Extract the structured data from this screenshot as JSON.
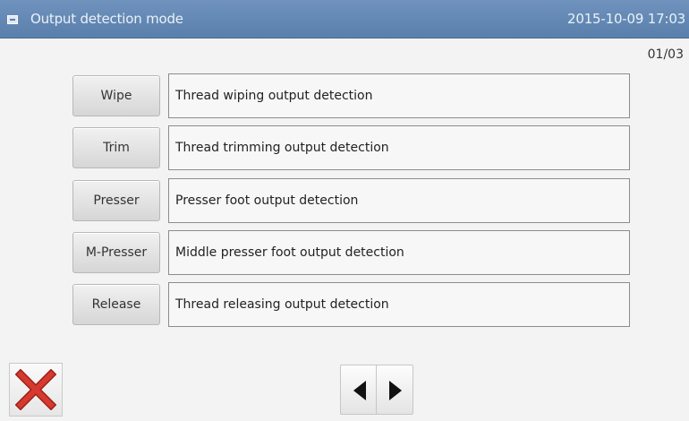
{
  "window": {
    "title": "Output detection mode",
    "datetime": "2015-10-09 17:03"
  },
  "page_indicator": "01/03",
  "items": [
    {
      "button": "Wipe",
      "description": "Thread wiping output detection"
    },
    {
      "button": "Trim",
      "description": "Thread trimming output detection"
    },
    {
      "button": "Presser",
      "description": "Presser foot output detection"
    },
    {
      "button": "M-Presser",
      "description": "Middle presser foot output detection"
    },
    {
      "button": "Release",
      "description": "Thread releasing output detection"
    }
  ],
  "icons": {
    "window": "window-icon",
    "close": "close-icon",
    "prev": "arrow-left-icon",
    "next": "arrow-right-icon"
  },
  "colors": {
    "titlebar": "#5f84b2",
    "close_cross": "#d0342c"
  }
}
